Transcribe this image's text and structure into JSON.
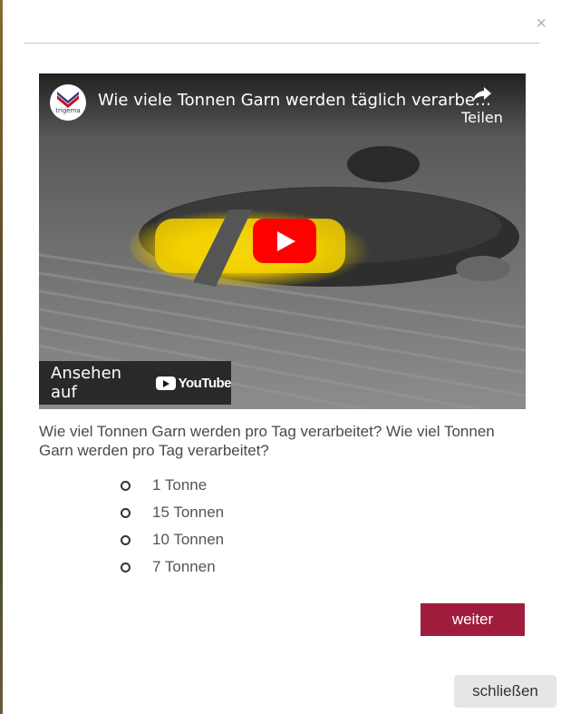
{
  "dialog": {
    "close_symbol": "×"
  },
  "video": {
    "channel_name": "trigema",
    "title": "Wie viele Tonnen Garn werden täglich verarbe…",
    "share_label": "Teilen",
    "share_icon": "share-arrow-icon",
    "watch_on_label": "Ansehen auf",
    "youtube_label": "YouTube",
    "play_icon": "play-icon",
    "colors": {
      "play_button": "#ff0000",
      "glow": "#f5d400"
    }
  },
  "quiz": {
    "question": "Wie viel Tonnen Garn werden pro Tag verarbeitet? Wie viel Tonnen Garn werden pro Tag verarbeitet?",
    "options": [
      "1 Tonne",
      "15 Tonnen",
      "10 Tonnen",
      "7 Tonnen"
    ]
  },
  "buttons": {
    "next_label": "weiter",
    "close_label": "schließen"
  },
  "colors": {
    "accent": "#a01c3c",
    "secondary_button": "#e6e6e6"
  }
}
